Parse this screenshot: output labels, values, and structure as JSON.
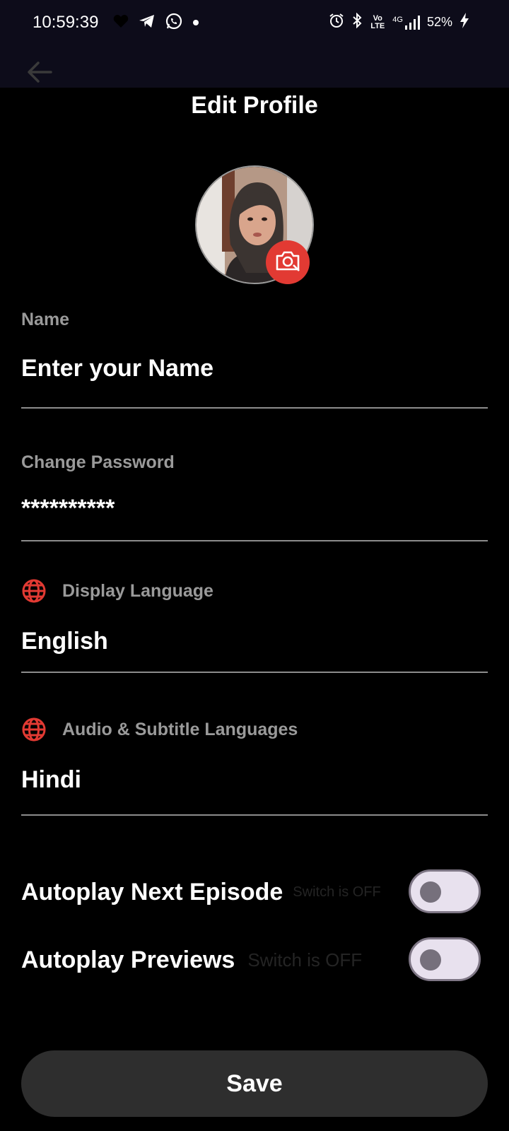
{
  "status_bar": {
    "time": "10:59:39",
    "battery": "52%",
    "left_icons": [
      "heart-icon",
      "telegram-icon",
      "whatsapp-icon",
      "dot-icon"
    ],
    "right_icons": [
      "alarm-icon",
      "bluetooth-icon",
      "volte-icon",
      "4g-signal-icon",
      "battery-charging-icon"
    ],
    "network_volte": "Vo LTE",
    "network_type": "4G"
  },
  "header": {
    "title": "Edit Profile",
    "back_icon": "arrow-left-icon"
  },
  "profile": {
    "avatar_icon": "avatar-photo",
    "camera_icon": "camera-icon"
  },
  "fields": {
    "name_label": "Name",
    "name_placeholder": "Enter your Name",
    "password_label": "Change Password",
    "password_value": "**********",
    "display_language_label": "Display Language",
    "display_language_value": "English",
    "audio_language_label": "Audio & Subtitle Languages",
    "audio_language_value": "Hindi",
    "language_icon": "globe-icon"
  },
  "toggles": [
    {
      "label": "Autoplay Next Episode",
      "hint": "Switch is OFF",
      "state": "off"
    },
    {
      "label": "Autoplay Previews",
      "hint": "Switch is OFF",
      "state": "off"
    }
  ],
  "actions": {
    "save_label": "Save"
  },
  "colors": {
    "accent": "#e23a33",
    "background": "#000000",
    "statusbar": "#0d0c1a",
    "button": "#2e2e2e",
    "label_gray": "#9a9a9a",
    "switch_track": "#e8e1ee"
  }
}
